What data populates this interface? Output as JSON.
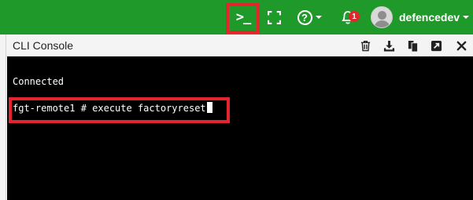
{
  "header": {
    "cli_glyph": ">_",
    "help_glyph": "?",
    "notification_count": "1",
    "username": "defencedev",
    "accent_color": "#1f9a2a",
    "highlight_color": "#e3262b"
  },
  "icons": {
    "cli": "terminal-icon",
    "fullscreen": "fullscreen-icon",
    "help": "help-circle-icon",
    "notifications": "bell-icon",
    "user": "avatar-icon",
    "clear": "trash-icon",
    "download": "download-icon",
    "copy": "copy-icon",
    "detach": "detach-icon",
    "close": "close-icon"
  },
  "panel": {
    "title": "CLI Console"
  },
  "terminal": {
    "status_line": "Connected",
    "prompt": "fgt-remote1 #",
    "command": "execute factoryreset"
  }
}
